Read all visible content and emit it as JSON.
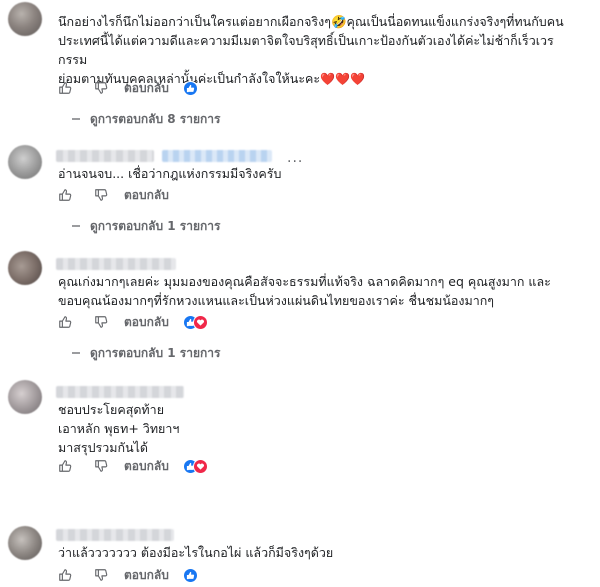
{
  "comments": [
    {
      "text": "นึกอย่างไรก็นึกไม่ออกว่าเป็นใครแต่อยากเผือกจริงๆ🤣คุณเป็นนี่อดทนแข็งแกร่งจริงๆที่ทนกับคน\nประเทศนี้ได้แต่ความดีและความมีเมตาจิตใจบริสุทธิ์เป็นเกาะป้องกันตัวเองได้ค่ะไม่ช้าก็เร็วเวรกรรม\nย่อมตามทันบุคคลเหล่านั้นค่ะเป็นกำลังใจให้นะคะ",
      "hearts": "❤️❤️❤️",
      "reply_label": "ตอบกลับ",
      "more_replies": "ดูการตอบกลับ 8 รายการ"
    },
    {
      "text": "อ่านจนจบ... เชื่อว่ากฎแห่งกรรมมีจริงครับ",
      "reply_label": "ตอบกลับ",
      "more_replies": "ดูการตอบกลับ 1 รายการ",
      "options": "···"
    },
    {
      "text": "คุณเก่งมากๆเลยค่ะ มุมมองของคุณคือสัจจะธรรมที่แท้จริง ฉลาดคิดมากๆ eq คุณสูงมาก และ\nขอบคุณน้องมากๆที่รักหวงแหนและเป็นห่วงแผ่นดินไทยของเราค่ะ ชื่นชมน้องมากๆ",
      "reply_label": "ตอบกลับ",
      "more_replies": "ดูการตอบกลับ 1 รายการ"
    },
    {
      "text": "ชอบประโยคสุดท้าย\nเอาหลัก พุธท+ วิทยาฯ\nมาสรุปรวมกันได้",
      "reply_label": "ตอบกลับ"
    },
    {
      "text": "ว่าแล้ววววววว ต้องมีอะไรในกอไผ่ แล้วก็มีจริงๆด้วย",
      "reply_label": "ตอบกลับ"
    }
  ],
  "colors": {
    "like_blue": "#1877f2",
    "care_red": "#f02849",
    "muted": "#65676b"
  }
}
